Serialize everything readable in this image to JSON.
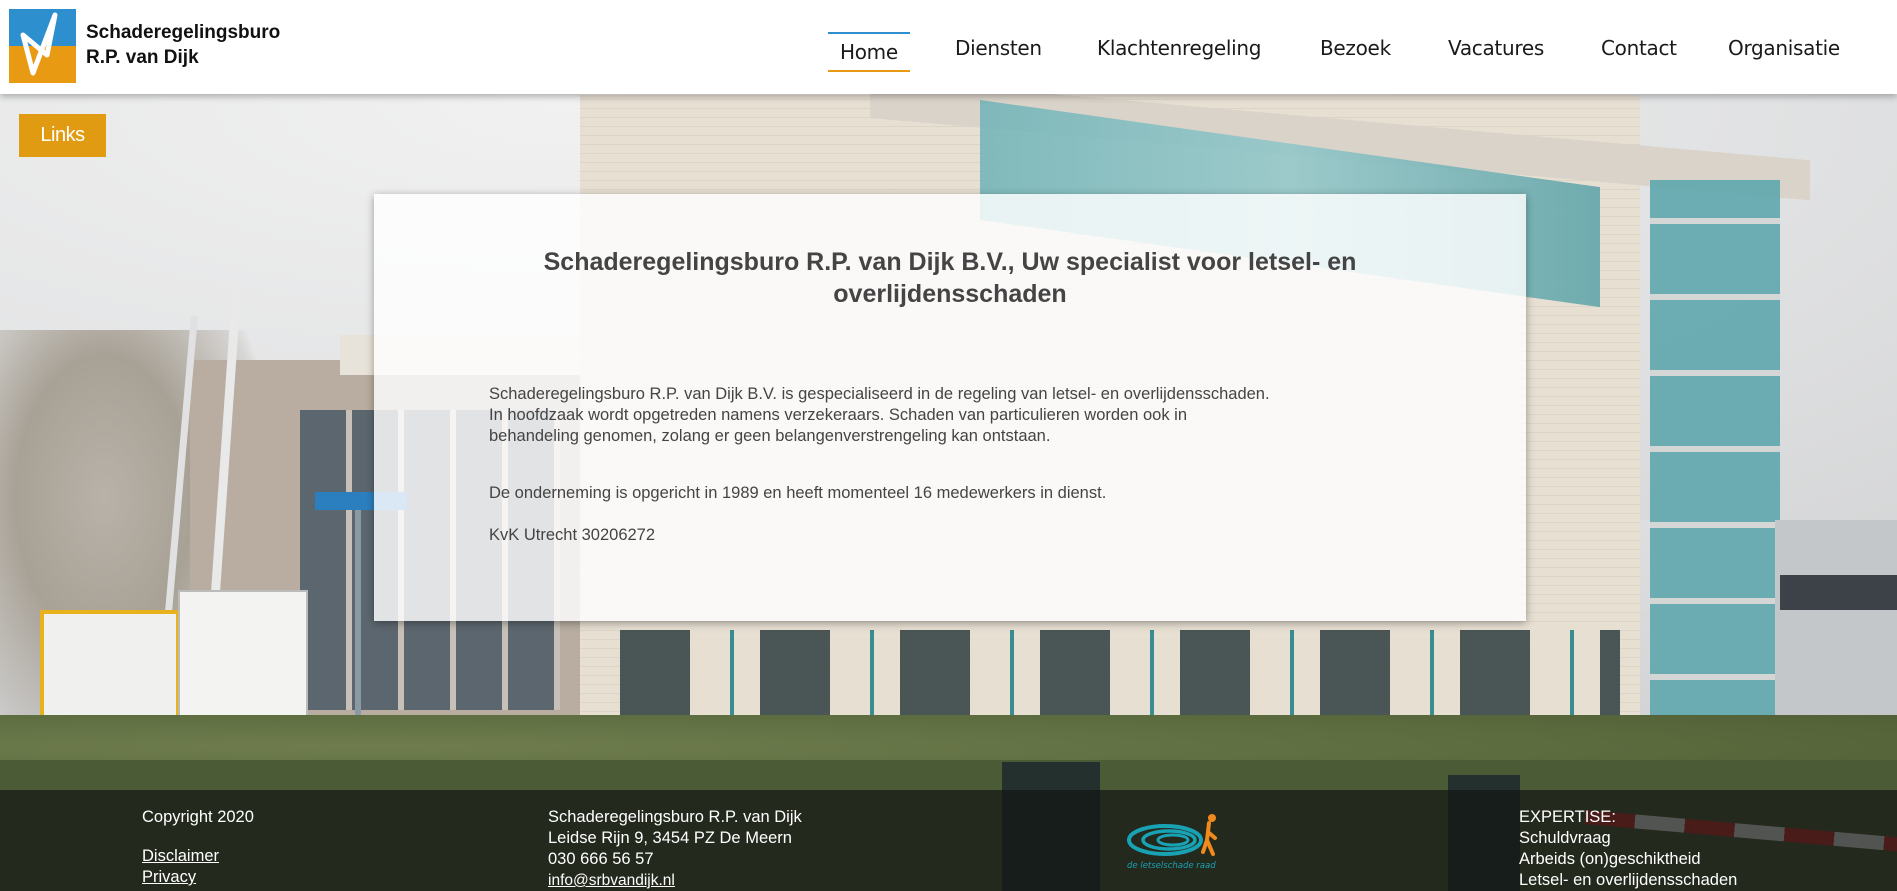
{
  "brand": {
    "name_line1": "Schaderegelingsburo",
    "name_line2": "R.P. van Dijk",
    "colors": {
      "blue": "#2e8fce",
      "orange": "#e89a12"
    }
  },
  "nav": {
    "items": [
      {
        "label": "Home",
        "active": true
      },
      {
        "label": "Diensten",
        "active": false
      },
      {
        "label": "Klachtenregeling",
        "active": false
      },
      {
        "label": "Bezoek",
        "active": false
      },
      {
        "label": "Vacatures",
        "active": false
      },
      {
        "label": "Contact",
        "active": false
      },
      {
        "label": "Organisatie",
        "active": false
      }
    ]
  },
  "links_button": {
    "label": "Links"
  },
  "main": {
    "title_line1": "Schaderegelingsburo R.P. van Dijk B.V., Uw specialist voor letsel- en",
    "title_line2": "overlijdensschaden",
    "intro_lines": [
      "Schaderegelingsburo R.P. van Dijk B.V. is gespecialiseerd in de regeling van letsel- en overlijdensschaden.",
      "In hoofdzaak wordt opgetreden namens verzekeraars. Schaden van particulieren worden ook in",
      "behandeling genomen, zolang er geen belangenverstrengeling kan ontstaan."
    ],
    "founded": "De onderneming is opgericht in 1989 en heeft momenteel 16 medewerkers in dienst.",
    "kvk": "KvK Utrecht 30206272"
  },
  "footer": {
    "copyright": "Copyright 2020",
    "disclaimer": "Disclaimer",
    "privacy": "Privacy",
    "address": {
      "name": "Schaderegelingsburo R.P. van Dijk",
      "street": "Leidse Rijn 9, 3454 PZ De Meern",
      "phone": "030 666 56 57",
      "email": "info@srbvandijk.nl"
    },
    "badge_label": "de letselschade raad",
    "expertise": {
      "heading": "EXPERTISE:",
      "items": [
        "Schuldvraag",
        "Arbeids (on)geschiktheid",
        "Letsel- en overlijdensschaden"
      ]
    }
  }
}
